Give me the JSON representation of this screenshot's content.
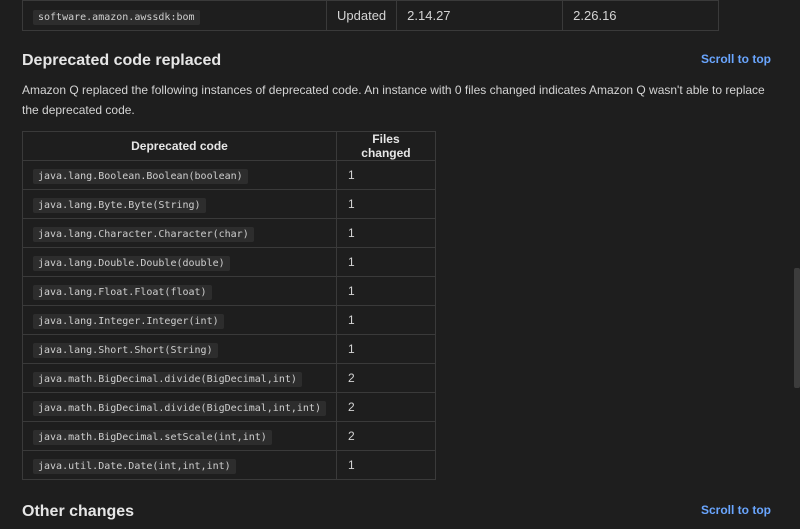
{
  "dependency_row": {
    "name": "software.amazon.awssdk:bom",
    "action": "Updated",
    "from_version": "2.14.27",
    "to_version": "2.26.16"
  },
  "deprecated_section": {
    "title": "Deprecated code replaced",
    "scroll_label": "Scroll to top",
    "description": "Amazon Q replaced the following instances of deprecated code. An instance with 0 files changed indicates Amazon Q wasn't able to replace the deprecated code.",
    "headers": {
      "code": "Deprecated code",
      "files": "Files changed"
    },
    "rows": [
      {
        "code": "java.lang.Boolean.Boolean(boolean)",
        "files": "1"
      },
      {
        "code": "java.lang.Byte.Byte(String)",
        "files": "1"
      },
      {
        "code": "java.lang.Character.Character(char)",
        "files": "1"
      },
      {
        "code": "java.lang.Double.Double(double)",
        "files": "1"
      },
      {
        "code": "java.lang.Float.Float(float)",
        "files": "1"
      },
      {
        "code": "java.lang.Integer.Integer(int)",
        "files": "1"
      },
      {
        "code": "java.lang.Short.Short(String)",
        "files": "1"
      },
      {
        "code": "java.math.BigDecimal.divide(BigDecimal,int)",
        "files": "2"
      },
      {
        "code": "java.math.BigDecimal.divide(BigDecimal,int,int)",
        "files": "2"
      },
      {
        "code": "java.math.BigDecimal.setScale(int,int)",
        "files": "2"
      },
      {
        "code": "java.util.Date.Date(int,int,int)",
        "files": "1"
      }
    ]
  },
  "other_section": {
    "title": "Other changes",
    "scroll_label": "Scroll to top"
  },
  "colors": {
    "background": "#1e1e1e",
    "link": "#6aa6ff",
    "border": "#3a3a3a",
    "code_bg": "#2d2d2d"
  }
}
